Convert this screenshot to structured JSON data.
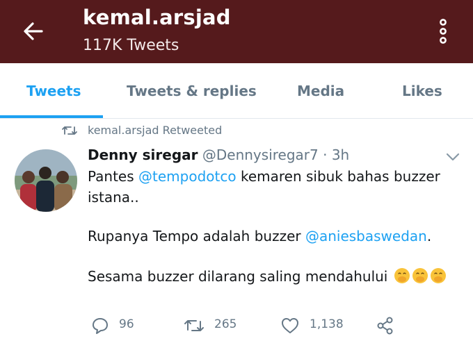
{
  "header": {
    "title": "kemal.arsjad",
    "tweet_count": "117K Tweets",
    "back_icon": "arrow-left-icon",
    "more_icon": "more-vertical-icon",
    "background": "#551a1c"
  },
  "tabs": [
    {
      "label": "Tweets",
      "active": true
    },
    {
      "label": "Tweets & replies",
      "active": false
    },
    {
      "label": "Media",
      "active": false
    },
    {
      "label": "Likes",
      "active": false
    }
  ],
  "accent_color": "#1da1f2",
  "tweet": {
    "retweet_notice": "kemal.arsjad Retweeted",
    "author_name": "Denny siregar",
    "author_handle": "@Dennysiregar7",
    "separator": " · ",
    "time": "3h",
    "lines": [
      {
        "pre": "Pantes ",
        "mention": "@tempodotco",
        "post": " kemaren sibuk bahas buzzer"
      },
      {
        "text": "istana.."
      },
      {
        "pre": "Rupanya Tempo adalah buzzer ",
        "mention": "@aniesbaswedan",
        "post": "."
      },
      {
        "text": "Sesama buzzer dilarang saling mendahului "
      }
    ],
    "emoji": "face-with-hand-over-mouth-icon",
    "emoji_count": 3,
    "actions": {
      "replies": "96",
      "retweets": "265",
      "likes": "1,138"
    }
  }
}
